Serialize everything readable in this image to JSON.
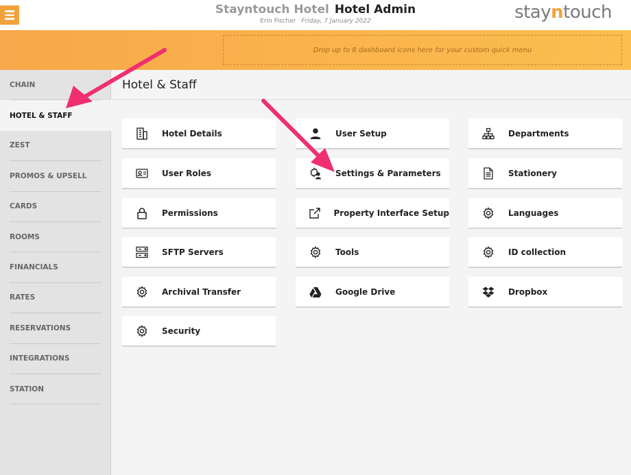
{
  "header": {
    "hotel_name": "Stayntouch Hotel",
    "app_name": "Hotel Admin",
    "user": "Erin Fischer",
    "date": "Friday, 7 January 2022",
    "logo": {
      "prefix": "stay",
      "accent": "n",
      "suffix": "touch"
    }
  },
  "quick_menu": {
    "placeholder": "Drop up to 8 dashboard icons here for your custom quick menu"
  },
  "sidebar": {
    "items": [
      {
        "label": "CHAIN"
      },
      {
        "label": "HOTEL & STAFF",
        "active": true
      },
      {
        "label": "ZEST"
      },
      {
        "label": "PROMOS & UPSELL"
      },
      {
        "label": "CARDS"
      },
      {
        "label": "ROOMS"
      },
      {
        "label": "FINANCIALS"
      },
      {
        "label": "RATES"
      },
      {
        "label": "RESERVATIONS"
      },
      {
        "label": "INTEGRATIONS"
      },
      {
        "label": "STATION"
      }
    ]
  },
  "main": {
    "title": "Hotel & Staff",
    "tiles": {
      "hotel_details": {
        "label": "Hotel Details",
        "icon": "building-icon"
      },
      "user_roles": {
        "label": "User Roles",
        "icon": "id-card-icon"
      },
      "permissions": {
        "label": "Permissions",
        "icon": "lock-icon"
      },
      "sftp_servers": {
        "label": "SFTP Servers",
        "icon": "server-icon"
      },
      "archival_transfer": {
        "label": "Archival Transfer",
        "icon": "gear-icon"
      },
      "security": {
        "label": "Security",
        "icon": "gear-icon"
      },
      "user_setup": {
        "label": "User Setup",
        "icon": "user-icon"
      },
      "settings_parameters": {
        "label": "Settings & Parameters",
        "icon": "user-gear-icon"
      },
      "property_interface_setup": {
        "label": "Property Interface Setup",
        "icon": "external-link-icon"
      },
      "tools": {
        "label": "Tools",
        "icon": "gear-icon"
      },
      "google_drive": {
        "label": "Google Drive",
        "icon": "google-drive-icon"
      },
      "departments": {
        "label": "Departments",
        "icon": "org-chart-icon"
      },
      "stationery": {
        "label": "Stationery",
        "icon": "document-icon"
      },
      "languages": {
        "label": "Languages",
        "icon": "gear-icon"
      },
      "id_collection": {
        "label": "ID collection",
        "icon": "gear-icon"
      },
      "dropbox": {
        "label": "Dropbox",
        "icon": "dropbox-icon"
      }
    }
  },
  "colors": {
    "accent": "#f2a23b",
    "arrow": "#ef2f6e"
  }
}
